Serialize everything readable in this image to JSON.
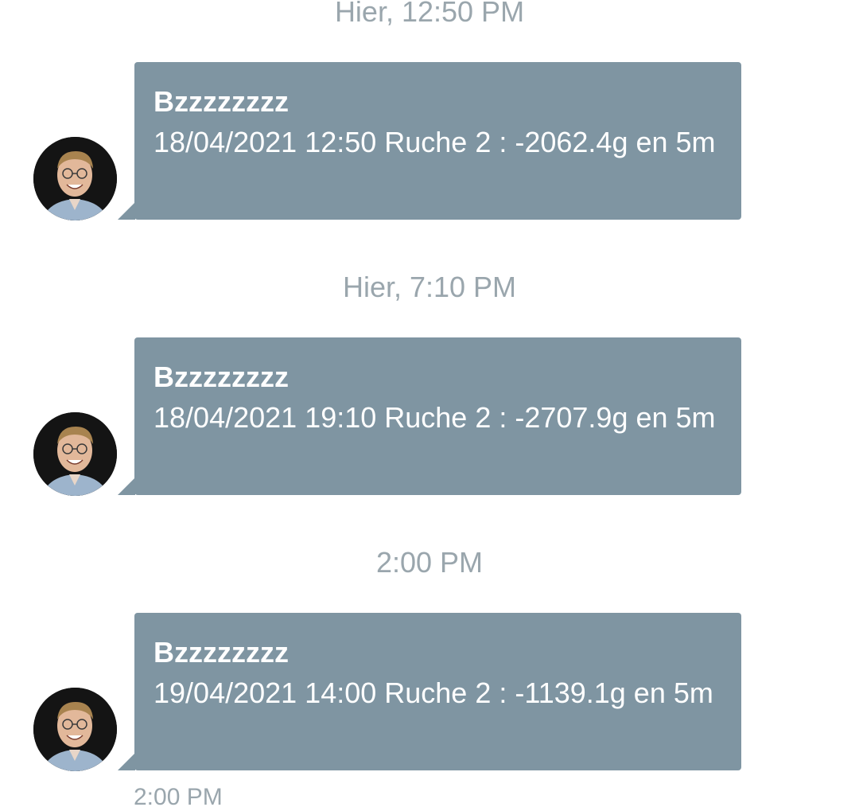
{
  "messages": [
    {
      "timestamp": "Hier, 12:50 PM",
      "sender": "Bzzzzzzzz",
      "text": "18/04/2021 12:50 Ruche 2 : -2062.4g en 5m",
      "avatar_icon": "person-avatar"
    },
    {
      "timestamp": "Hier, 7:10 PM",
      "sender": "Bzzzzzzzz",
      "text": "18/04/2021 19:10 Ruche 2 : -2707.9g en 5m",
      "avatar_icon": "person-avatar"
    },
    {
      "timestamp": "2:00 PM",
      "sender": "Bzzzzzzzz",
      "text": "19/04/2021 14:00 Ruche 2 : -1139.1g en 5m",
      "avatar_icon": "person-avatar"
    }
  ],
  "footer_timestamp": "2:00 PM",
  "colors": {
    "bubble": "#7f95a2",
    "timestamp": "#9aa6ad",
    "background": "#ffffff"
  }
}
